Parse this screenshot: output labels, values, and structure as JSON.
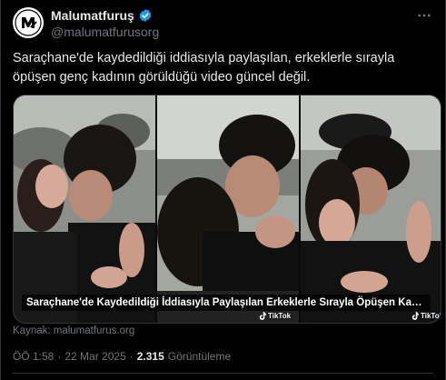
{
  "account": {
    "display_name": "Malumatfuruş",
    "handle": "@malumatfurusorg",
    "verified": true,
    "avatar_icon": "malumatfurus-logo"
  },
  "tweet": {
    "text": "Saraçhane'de kaydedildiği iddiasıyla paylaşılan, erkeklerle sırayla öpüşen genç kadının görüldüğü video güncel değil."
  },
  "media": {
    "caption": "Saraçhane'de Kaydedildiği İddiasıyla Paylaşılan Erkeklerle Sırayla Öpüşen Kadının Gör...",
    "watermark_1": "TikTok",
    "watermark_2": "TikTok"
  },
  "source": {
    "label": "Kaynak: malumatfurus.org"
  },
  "meta": {
    "time": "ÖÖ 1:58",
    "separator_1": "·",
    "date": "22 Mar 2025",
    "separator_2": "·",
    "views_count": "2.315",
    "views_label": "Görüntüleme"
  },
  "colors": {
    "background": "#000000",
    "text_primary": "#e7e9ea",
    "text_secondary": "#71767b",
    "verified_blue": "#1d9bf0",
    "border": "#2f3336"
  }
}
